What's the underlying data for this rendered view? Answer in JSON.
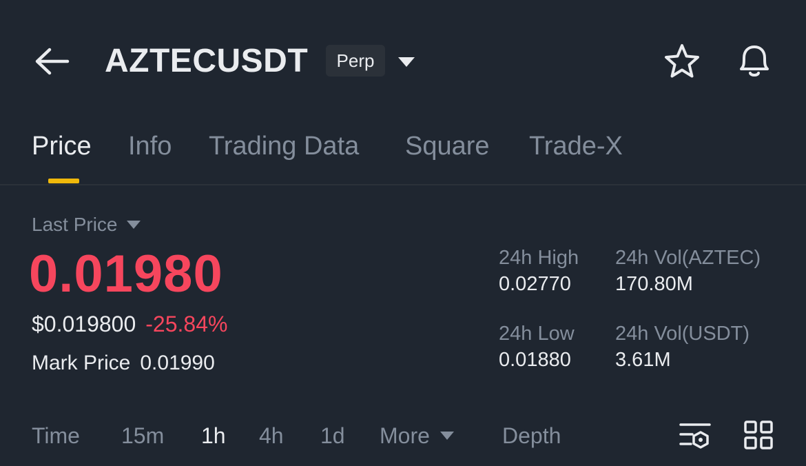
{
  "header": {
    "symbol": "AZTECUSDT",
    "contract_badge": "Perp",
    "back_icon": "arrow-left-icon",
    "caret_icon": "caret-down-icon",
    "favorite_icon": "star-icon",
    "alert_icon": "bell-icon"
  },
  "tabs": [
    {
      "label": "Price",
      "active": true
    },
    {
      "label": "Info",
      "active": false
    },
    {
      "label": "Trading Data",
      "active": false
    },
    {
      "label": "Square",
      "active": false
    },
    {
      "label": "Trade-X",
      "active": false
    }
  ],
  "price": {
    "label": "Last Price",
    "last": "0.01980",
    "usd": "$0.019800",
    "change": "-25.84%",
    "mark_label": "Mark Price",
    "mark_value": "0.01990"
  },
  "stats": {
    "high": {
      "label": "24h High",
      "value": "0.02770"
    },
    "vol_base": {
      "label": "24h Vol(AZTEC)",
      "value": "170.80M"
    },
    "low": {
      "label": "24h Low",
      "value": "0.01880"
    },
    "vol_quote": {
      "label": "24h Vol(USDT)",
      "value": "3.61M"
    }
  },
  "timebar": {
    "items": [
      {
        "label": "Time",
        "active": false
      },
      {
        "label": "15m",
        "active": false
      },
      {
        "label": "1h",
        "active": true
      },
      {
        "label": "4h",
        "active": false
      },
      {
        "label": "1d",
        "active": false
      }
    ],
    "more": "More",
    "depth": "Depth",
    "indicator_icon": "indicator-settings-icon",
    "layout_icon": "grid-layout-icon"
  },
  "colors": {
    "background": "#1f2630",
    "accent": "#f0b90b",
    "down": "#f6465d",
    "muted": "#848e9c",
    "text": "#eaecef"
  }
}
